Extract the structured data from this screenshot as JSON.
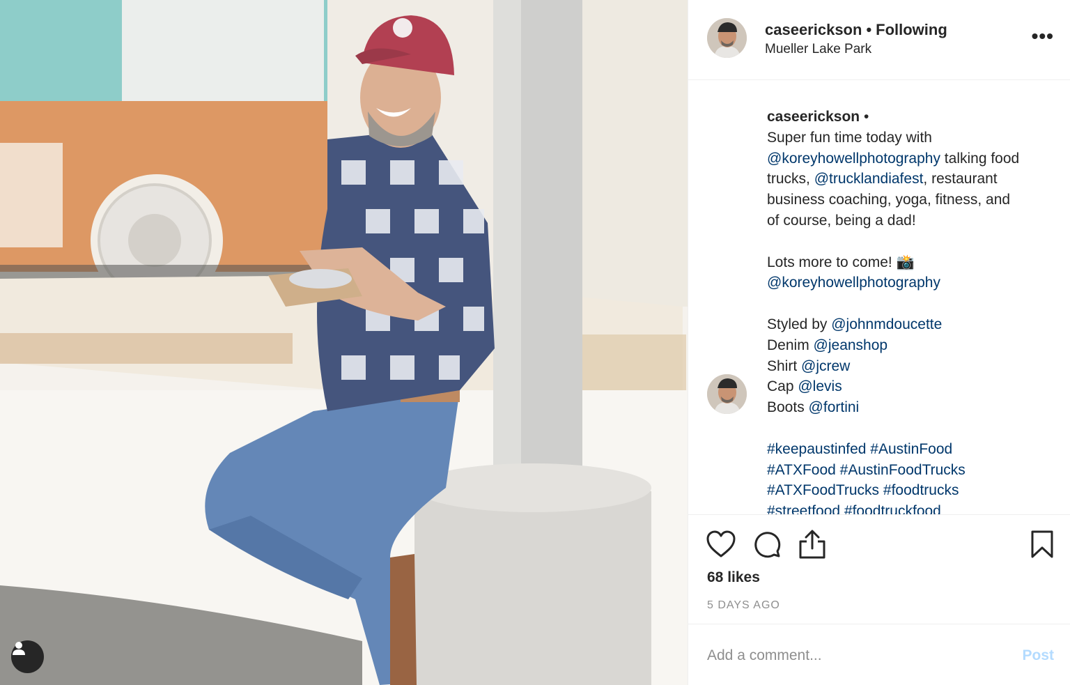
{
  "header": {
    "username": "caseerickson",
    "separator": "•",
    "follow_status": "Following",
    "location": "Mueller Lake Park",
    "more_label": "•••"
  },
  "caption": {
    "username": "caseerickson",
    "username_dot": "•",
    "lines": [
      {
        "parts": [
          {
            "t": "text",
            "v": "Super fun time today with"
          }
        ]
      },
      {
        "parts": [
          {
            "t": "mention",
            "v": "@koreyhowellphotography"
          },
          {
            "t": "text",
            "v": " talking food"
          }
        ]
      },
      {
        "parts": [
          {
            "t": "text",
            "v": "trucks, "
          },
          {
            "t": "mention",
            "v": "@trucklandiafest"
          },
          {
            "t": "text",
            "v": ", restaurant"
          }
        ]
      },
      {
        "parts": [
          {
            "t": "text",
            "v": "business coaching, yoga, fitness, and"
          }
        ]
      },
      {
        "parts": [
          {
            "t": "text",
            "v": "of course, being a dad!"
          }
        ]
      },
      {
        "parts": []
      },
      {
        "parts": [
          {
            "t": "text",
            "v": "Lots more to come! 📸"
          }
        ]
      },
      {
        "parts": [
          {
            "t": "mention",
            "v": "@koreyhowellphotography"
          }
        ]
      },
      {
        "parts": []
      },
      {
        "parts": [
          {
            "t": "text",
            "v": "Styled by "
          },
          {
            "t": "mention",
            "v": "@johnmdoucette"
          }
        ]
      },
      {
        "parts": [
          {
            "t": "text",
            "v": "Denim "
          },
          {
            "t": "mention",
            "v": "@jeanshop"
          }
        ]
      },
      {
        "parts": [
          {
            "t": "text",
            "v": "Shirt "
          },
          {
            "t": "mention",
            "v": "@jcrew"
          }
        ]
      },
      {
        "parts": [
          {
            "t": "text",
            "v": "Cap "
          },
          {
            "t": "mention",
            "v": "@levis"
          }
        ]
      },
      {
        "parts": [
          {
            "t": "text",
            "v": "Boots "
          },
          {
            "t": "mention",
            "v": "@fortini"
          }
        ]
      },
      {
        "parts": []
      },
      {
        "parts": [
          {
            "t": "hashtag",
            "v": "#keepaustinfed"
          },
          {
            "t": "text",
            "v": " "
          },
          {
            "t": "hashtag",
            "v": "#AustinFood"
          }
        ]
      },
      {
        "parts": [
          {
            "t": "hashtag",
            "v": "#ATXFood"
          },
          {
            "t": "text",
            "v": " "
          },
          {
            "t": "hashtag",
            "v": "#AustinFoodTrucks"
          }
        ]
      },
      {
        "parts": [
          {
            "t": "hashtag",
            "v": "#ATXFoodTrucks"
          },
          {
            "t": "text",
            "v": " "
          },
          {
            "t": "hashtag",
            "v": "#foodtrucks"
          }
        ]
      },
      {
        "parts": [
          {
            "t": "hashtag",
            "v": "#streetfood"
          },
          {
            "t": "text",
            "v": " "
          },
          {
            "t": "hashtag",
            "v": "#foodtruckfood"
          }
        ]
      }
    ]
  },
  "actions": {
    "like_icon": "heart-icon",
    "comment_icon": "comment-bubble-icon",
    "share_icon": "share-upload-icon",
    "save_icon": "bookmark-icon",
    "likes": "68 likes",
    "time_ago": "5 DAYS AGO"
  },
  "comment": {
    "placeholder": "Add a comment...",
    "post_label": "Post"
  },
  "photo": {
    "tag_icon": "user-tag-icon"
  },
  "colors": {
    "link": "#00376b",
    "muted": "#8e8e8e",
    "post_disabled": "#b3dbff",
    "border": "#efefef"
  }
}
